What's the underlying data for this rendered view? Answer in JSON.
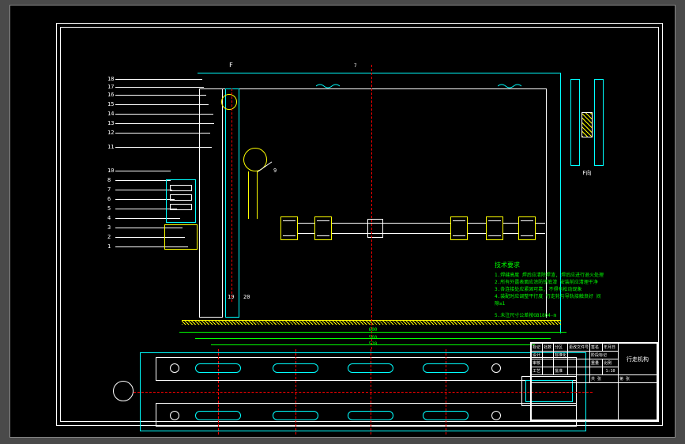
{
  "drawing": {
    "section_mark": "F",
    "section_view_label": "F向",
    "callouts": [
      "1",
      "2",
      "3",
      "4",
      "5",
      "6",
      "7",
      "8",
      "9",
      "10",
      "11",
      "12",
      "13",
      "14",
      "15",
      "16",
      "17",
      "18",
      "19",
      "20"
    ],
    "part_6_callout": "6",
    "part_9_callout": "9",
    "dim_overall": "600",
    "dim_width": "560",
    "dim_span": "520"
  },
  "notes": {
    "title": "技术要求",
    "items": [
      "1.焊缝高度 焊后应清除焊渣, 焊后应进行退火处理",
      "2.所有外露表面应涂防锈底漆 安装前应清理干净",
      "3.各连接处应紧固可靠, 不得有松动现象",
      "4.装配时应调整平行度 行走轮与导轨接触良好 间隙≤1",
      "5.未注尺寸公差按GB1804-m"
    ]
  },
  "titleblock": {
    "rows": [
      [
        "标记",
        "处数",
        "分区",
        "更改文件号",
        "签名",
        "年月日"
      ],
      [
        "设计",
        "",
        "标准化",
        "",
        "阶段标记",
        "重量",
        "比例"
      ],
      [
        "审核",
        "",
        "",
        "",
        "",
        "",
        "1:10"
      ],
      [
        "工艺",
        "",
        "批准",
        "",
        "共 张",
        "第 张",
        ""
      ]
    ],
    "name": "行走机构",
    "number": "",
    "material": ""
  }
}
